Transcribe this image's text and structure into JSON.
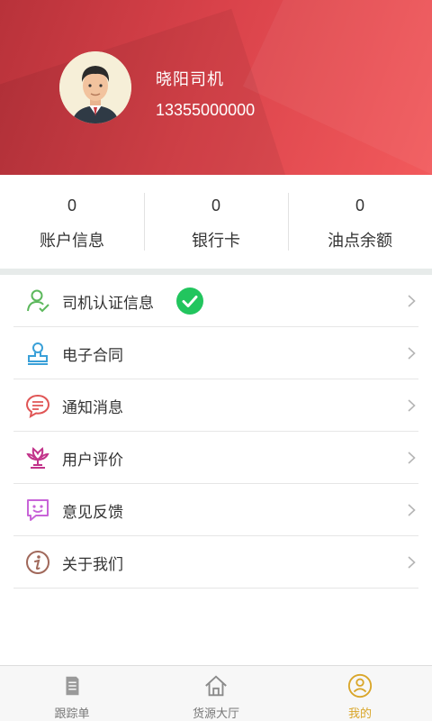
{
  "profile": {
    "name": "晓阳司机",
    "phone": "13355000000"
  },
  "stats": [
    {
      "value": "0",
      "label": "账户信息"
    },
    {
      "value": "0",
      "label": "银行卡"
    },
    {
      "value": "0",
      "label": "油点余额"
    }
  ],
  "menu": {
    "items": [
      {
        "label": "司机认证信息",
        "icon": "person-check-icon",
        "verified": true
      },
      {
        "label": "电子合同",
        "icon": "stamp-icon"
      },
      {
        "label": "通知消息",
        "icon": "message-bubble-icon"
      },
      {
        "label": "用户评价",
        "icon": "flower-icon"
      },
      {
        "label": "意见反馈",
        "icon": "smile-bubble-icon"
      },
      {
        "label": "关于我们",
        "icon": "info-icon"
      }
    ]
  },
  "tabbar": {
    "tabs": [
      {
        "label": "跟踪单",
        "icon": "document-icon",
        "active": false
      },
      {
        "label": "货源大厅",
        "icon": "home-icon",
        "active": false
      },
      {
        "label": "我的",
        "icon": "user-circle-icon",
        "active": true
      }
    ]
  },
  "colors": {
    "header_start": "#b8323a",
    "header_end": "#f25a5c",
    "verified_green": "#22c55e",
    "active_tab": "#d9a62a"
  }
}
